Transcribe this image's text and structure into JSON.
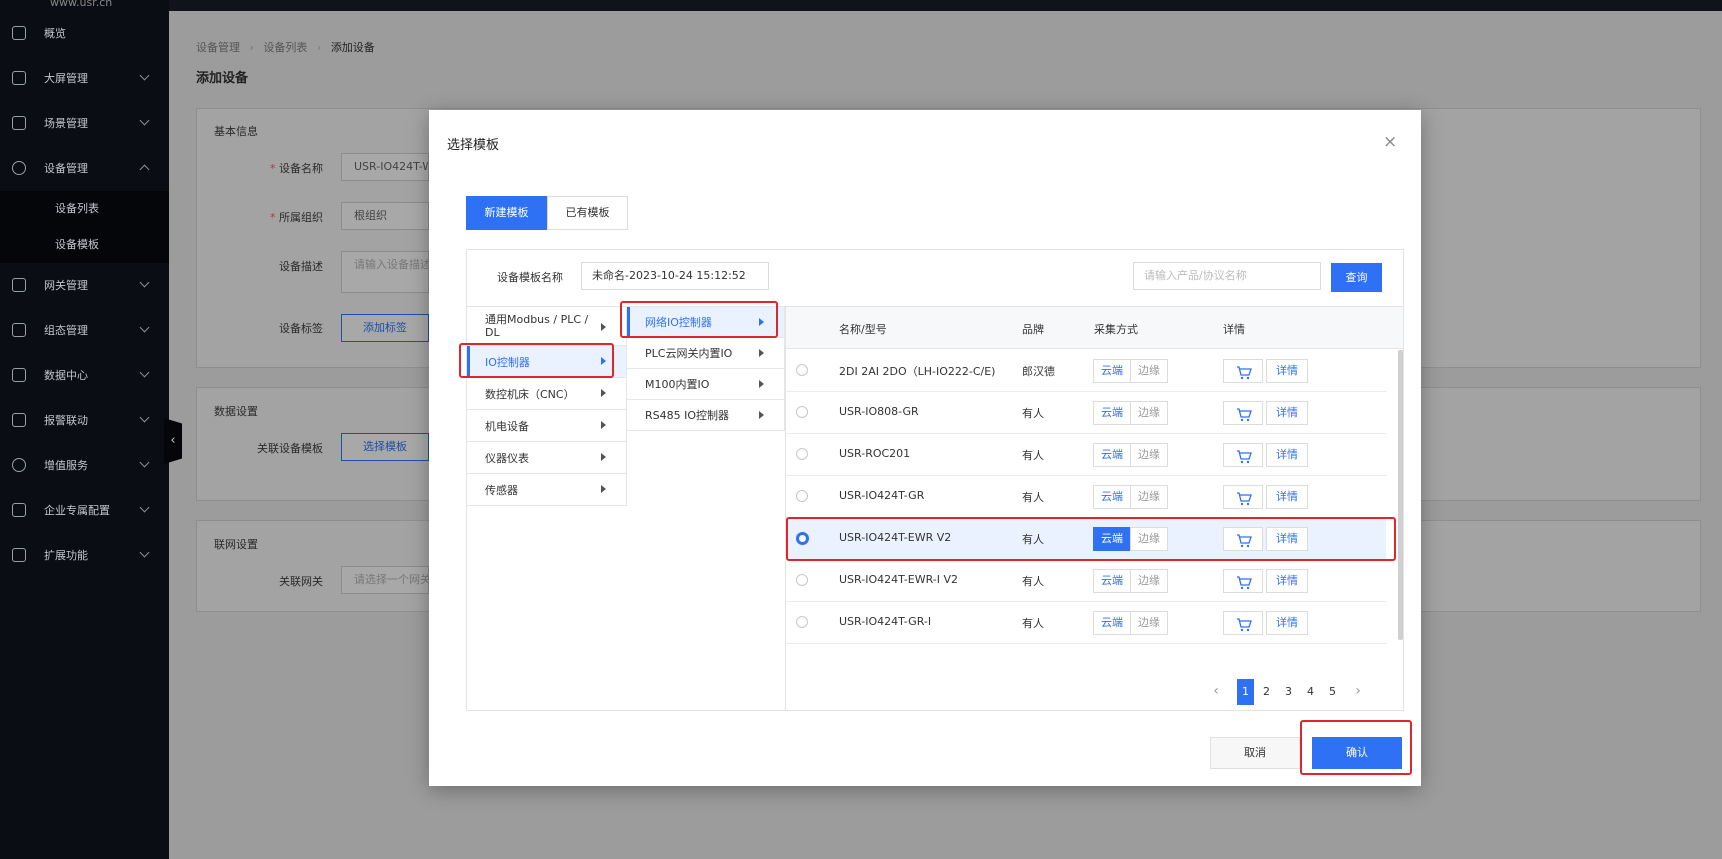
{
  "sidebar": {
    "logo_text": "www.usr.cn",
    "items": [
      {
        "label": "概览",
        "icon": "overview-icon",
        "has_chevron": false
      },
      {
        "label": "大屏管理",
        "icon": "monitor-icon",
        "has_chevron": true
      },
      {
        "label": "场景管理",
        "icon": "cube-icon",
        "has_chevron": true
      },
      {
        "label": "设备管理",
        "icon": "pie-icon",
        "has_chevron": true,
        "expanded": true
      },
      {
        "label": "网关管理",
        "icon": "gateway-icon",
        "has_chevron": true
      },
      {
        "label": "组态管理",
        "icon": "image-icon",
        "has_chevron": true
      },
      {
        "label": "数据中心",
        "icon": "bar-chart-icon",
        "has_chevron": true
      },
      {
        "label": "报警联动",
        "icon": "alarm-icon",
        "has_chevron": true
      },
      {
        "label": "增值服务",
        "icon": "coin-icon",
        "has_chevron": true
      },
      {
        "label": "企业专属配置",
        "icon": "enterprise-icon",
        "has_chevron": true
      },
      {
        "label": "扩展功能",
        "icon": "layers-icon",
        "has_chevron": true
      }
    ],
    "sub_items": [
      "设备列表",
      "设备模板"
    ],
    "collapse_glyph": "‹"
  },
  "breadcrumb": [
    "设备管理",
    "设备列表",
    "添加设备"
  ],
  "breadcrumb_sep": "›",
  "page_title": "添加设备",
  "basic_info": {
    "title": "基本信息",
    "required_mark": "*",
    "device_name_label": "设备名称",
    "device_name_value": "USR-IO424T-W",
    "org_label": "所属组织",
    "org_value": "根组织",
    "desc_label": "设备描述",
    "desc_placeholder": "请输入设备描述",
    "tag_label": "设备标签",
    "tag_button": "添加标签"
  },
  "data_settings": {
    "title": "数据设置",
    "template_label": "关联设备模板",
    "template_button": "选择模板"
  },
  "network_settings": {
    "title": "联网设置",
    "gateway_label": "关联网关",
    "gateway_placeholder": "请选择一个网关"
  },
  "modal": {
    "title": "选择模板",
    "close_glyph": "×",
    "tabs": [
      {
        "label": "新建模板",
        "active": true
      },
      {
        "label": "已有模板",
        "active": false
      }
    ],
    "template_name_label": "设备模板名称",
    "template_name_value": "未命名-2023-10-24 15:12:52",
    "search_placeholder": "请输入产品/协议名称",
    "search_button": "查询",
    "categories": [
      {
        "label": "通用Modbus / PLC / DL",
        "selected": false
      },
      {
        "label": "IO控制器",
        "selected": true
      },
      {
        "label": "数控机床（CNC）",
        "selected": false
      },
      {
        "label": "机电设备",
        "selected": false
      },
      {
        "label": "仪器仪表",
        "selected": false
      },
      {
        "label": "传感器",
        "selected": false
      }
    ],
    "subcategories": [
      {
        "label": "网络IO控制器",
        "selected": true
      },
      {
        "label": "PLC云网关内置IO",
        "selected": false
      },
      {
        "label": "M100内置IO",
        "selected": false
      },
      {
        "label": "RS485 IO控制器",
        "selected": false
      }
    ],
    "table": {
      "headers": [
        "名称/型号",
        "品牌",
        "采集方式",
        "详情"
      ],
      "cloud_label": "云端",
      "edge_label": "边缘",
      "detail_label": "详情",
      "rows": [
        {
          "name": "2DI 2AI 2DO（LH-IO222-C/E)",
          "brand": "郎汉德",
          "selected": false
        },
        {
          "name": "USR-IO808-GR",
          "brand": "有人",
          "selected": false
        },
        {
          "name": "USR-ROC201",
          "brand": "有人",
          "selected": false
        },
        {
          "name": "USR-IO424T-GR",
          "brand": "有人",
          "selected": false
        },
        {
          "name": "USR-IO424T-EWR V2",
          "brand": "有人",
          "selected": true
        },
        {
          "name": "USR-IO424T-EWR-I V2",
          "brand": "有人",
          "selected": false
        },
        {
          "name": "USR-IO424T-GR-I",
          "brand": "有人",
          "selected": false
        }
      ]
    },
    "pagination": {
      "prev": "‹",
      "next": "›",
      "pages": [
        "1",
        "2",
        "3",
        "4",
        "5"
      ],
      "current": "1"
    },
    "cancel_button": "取消",
    "confirm_button": "确认"
  },
  "colors": {
    "primary": "#2f71f5",
    "highlight": "#e0262d",
    "sidebar_bg": "#0b0d14"
  }
}
